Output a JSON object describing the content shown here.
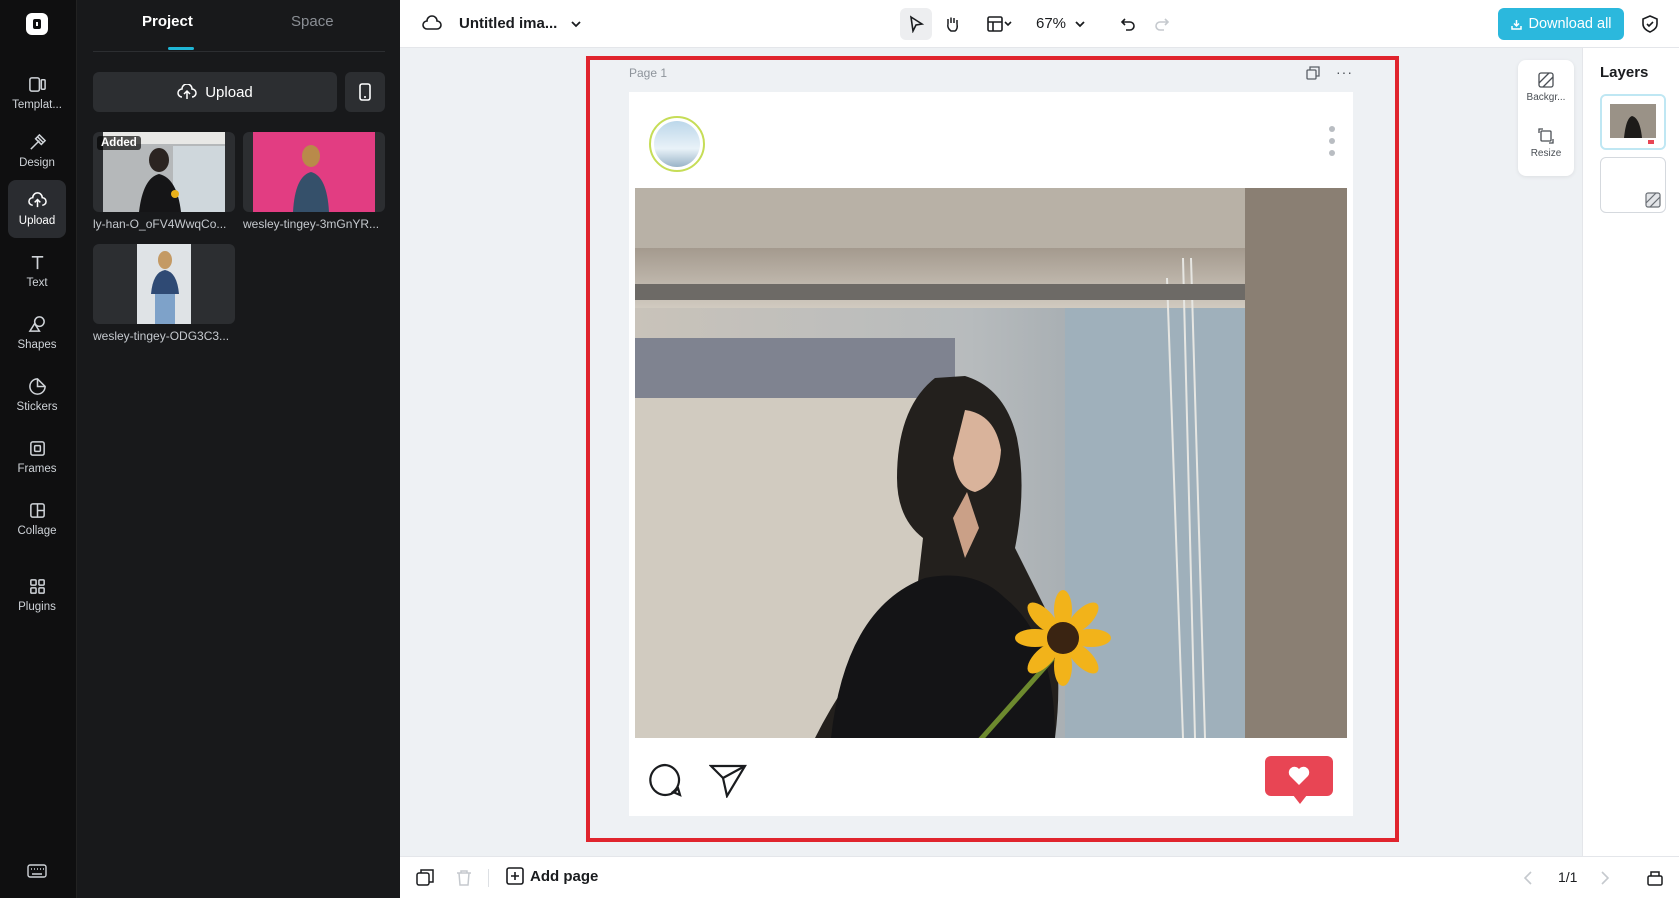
{
  "rail": {
    "items": [
      {
        "label": "Templat...",
        "icon": "templates-icon"
      },
      {
        "label": "Design",
        "icon": "design-icon"
      },
      {
        "label": "Upload",
        "icon": "upload-cloud-icon",
        "active": true
      },
      {
        "label": "Text",
        "icon": "text-icon"
      },
      {
        "label": "Shapes",
        "icon": "shapes-icon"
      },
      {
        "label": "Stickers",
        "icon": "stickers-icon"
      },
      {
        "label": "Frames",
        "icon": "frames-icon"
      },
      {
        "label": "Collage",
        "icon": "collage-icon"
      },
      {
        "label": "Plugins",
        "icon": "plugins-icon"
      }
    ]
  },
  "panel": {
    "tabs": {
      "project": "Project",
      "space": "Space"
    },
    "upload_label": "Upload",
    "assets": [
      {
        "name": "ly-han-O_oFV4WwqCo...",
        "badge": "Added"
      },
      {
        "name": "wesley-tingey-3mGnYR..."
      },
      {
        "name": "wesley-tingey-ODG3C3..."
      }
    ]
  },
  "topbar": {
    "title": "Untitled ima...",
    "zoom": "67%",
    "download_label": "Download all"
  },
  "canvas": {
    "page_label": "Page 1",
    "page_more": "···"
  },
  "float_tools": {
    "background": "Backgr...",
    "resize": "Resize"
  },
  "layers": {
    "title": "Layers"
  },
  "bottombar": {
    "add_page": "Add page",
    "page_count": "1/1"
  },
  "colors": {
    "accent": "#2bb8dd",
    "selection": "#e0242d",
    "heart": "#e84554"
  }
}
